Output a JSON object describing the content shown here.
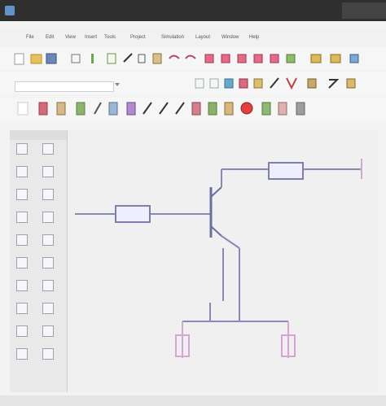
{
  "window": {
    "title": ""
  },
  "menu": [
    "File",
    "Edit",
    "View",
    "Insert",
    "Tools",
    "Project",
    "Simulation",
    "Layout",
    "Window",
    "Help"
  ],
  "toolbar": {
    "combo_placeholder": ""
  },
  "left_panel": {
    "header": ""
  },
  "schematic": {
    "labels": {
      "top_left_1": "",
      "top_left_2": "",
      "top_left_3": "",
      "top_left_4": "",
      "top_right_1": "",
      "top_right_2": "",
      "bottom_left_1": "",
      "bottom_left_2": "",
      "bottom_left_3": "",
      "bottom_left_4": "",
      "bottom_center_1": "",
      "bottom_center_2": "",
      "bottom_center_3": "",
      "bottom_center_4": ""
    }
  },
  "status": {
    "left": "",
    "mid": "",
    "right1": "",
    "right2": ""
  }
}
